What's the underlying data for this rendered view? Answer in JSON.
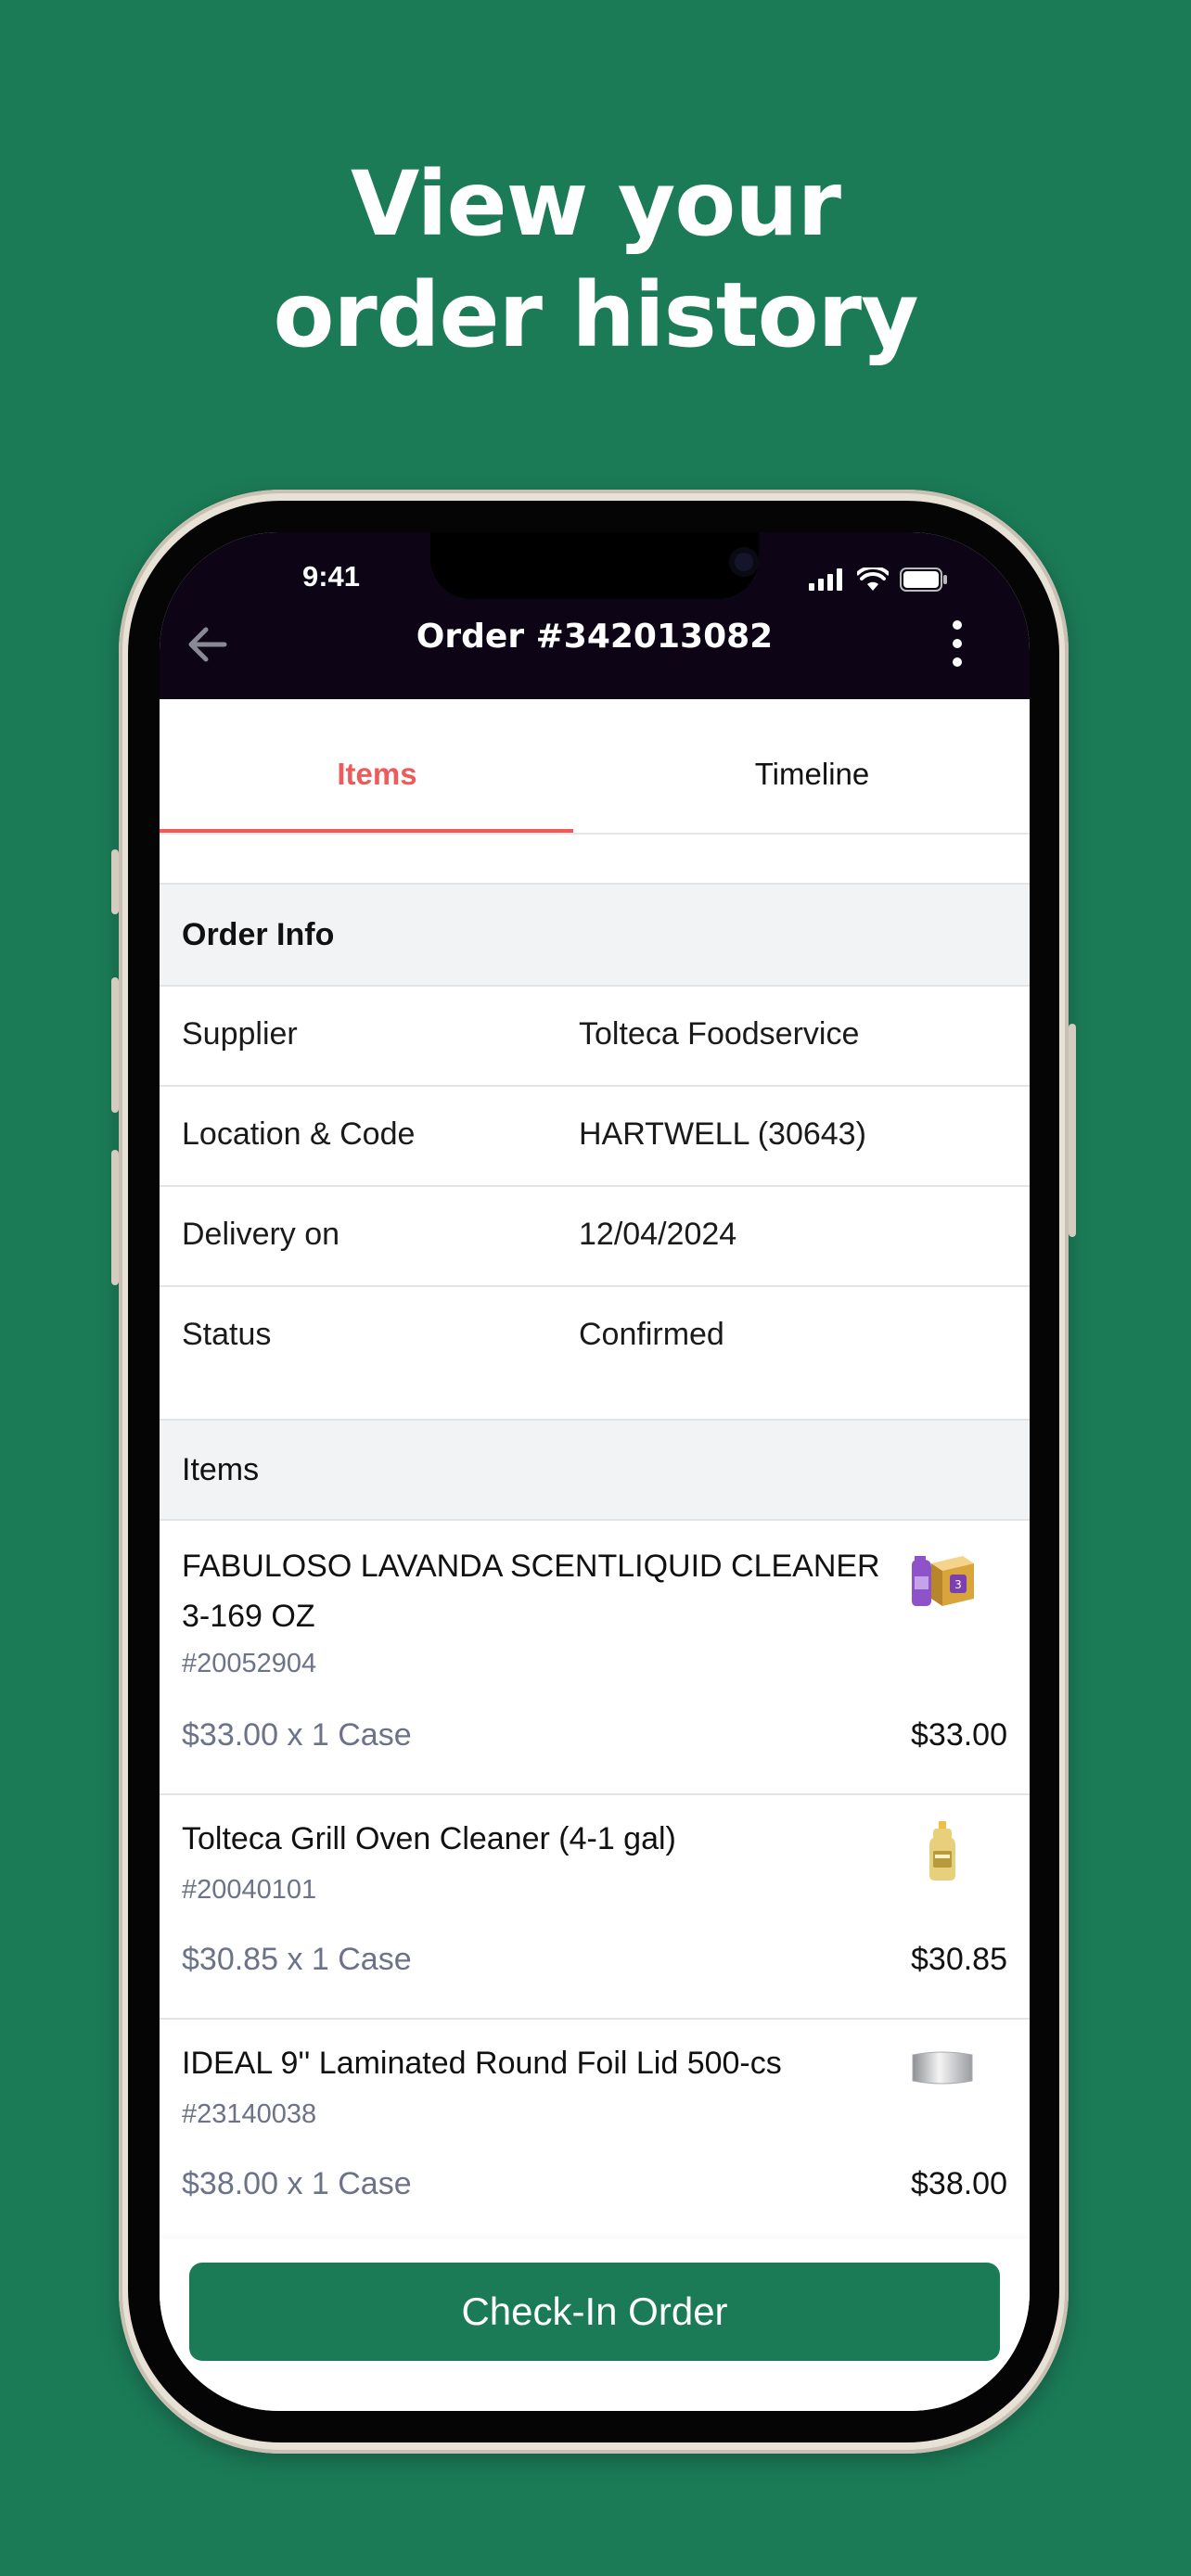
{
  "headline": {
    "line1": "View your",
    "line2": "order history"
  },
  "status_bar": {
    "time": "9:41"
  },
  "header": {
    "title": "Order #342013082"
  },
  "tabs": [
    {
      "label": "Items",
      "active": true
    },
    {
      "label": "Timeline",
      "active": false
    }
  ],
  "order_info": {
    "title": "Order Info",
    "rows": [
      {
        "label": "Supplier",
        "value": "Tolteca Foodservice"
      },
      {
        "label": "Location & Code",
        "value": "HARTWELL (30643)"
      },
      {
        "label": "Delivery on",
        "value": "12/04/2024"
      },
      {
        "label": "Status",
        "value": "Confirmed"
      }
    ]
  },
  "items_section": {
    "title": "Items",
    "items": [
      {
        "name": "FABULOSO LAVANDA SCENTLIQUID CLEANER 3-169 OZ",
        "sku": "#20052904",
        "qty": "$33.00 x 1 Case",
        "total": "$33.00",
        "image": "fabuloso-box-image"
      },
      {
        "name": "Tolteca Grill Oven Cleaner (4-1 gal)",
        "sku": "#20040101",
        "qty": "$30.85 x 1 Case",
        "total": "$30.85",
        "image": "cleaner-bottle-image"
      },
      {
        "name": "IDEAL 9'' Laminated Round Foil Lid 500-cs",
        "sku": "#23140038",
        "qty": "$38.00 x 1 Case",
        "total": "$38.00",
        "image": "foil-lid-image"
      }
    ]
  },
  "footer": {
    "button_label": "Check-In Order"
  },
  "colors": {
    "brand_green": "#1b7b57",
    "accent_red": "#ee5b5b",
    "header_dark": "#0d0515"
  }
}
